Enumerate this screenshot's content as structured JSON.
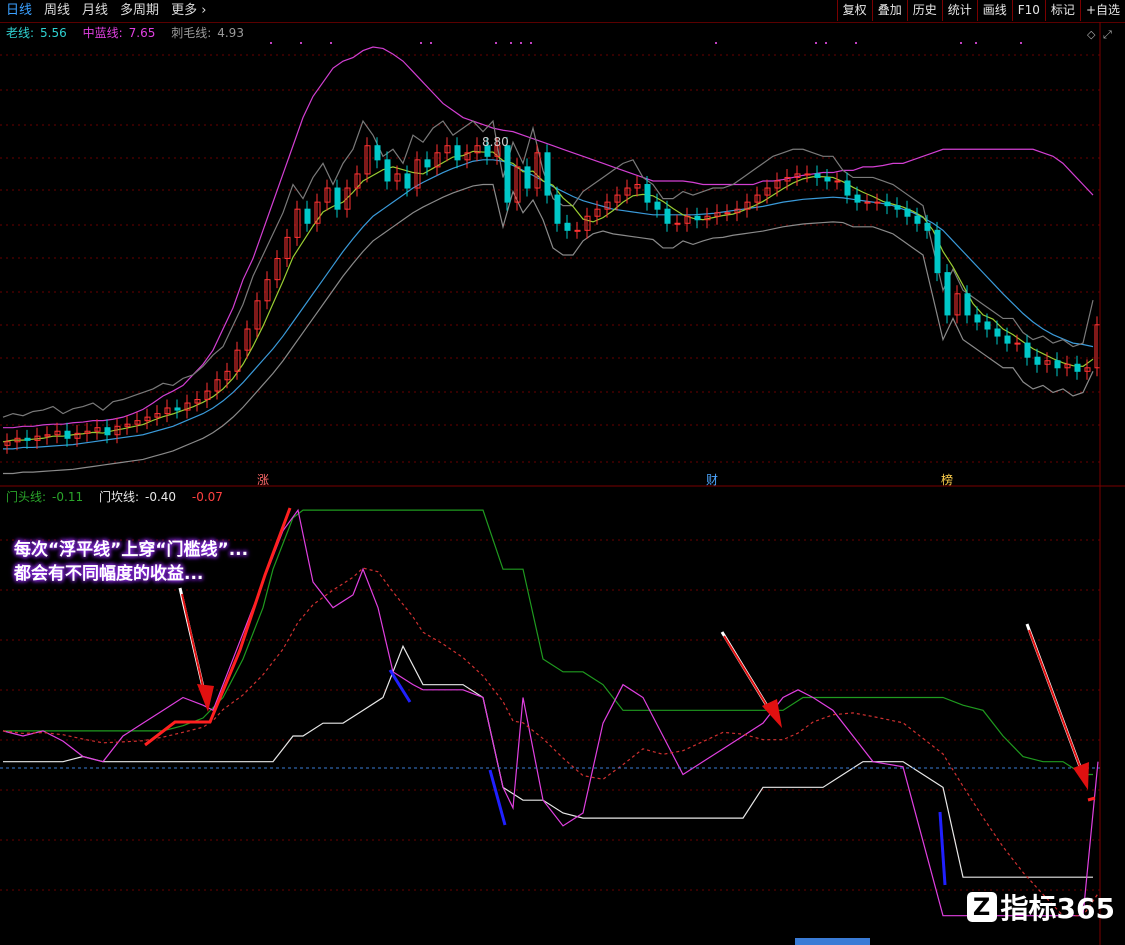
{
  "toolbar": {
    "tabs": [
      "日线",
      "周线",
      "月线",
      "多周期",
      "更多"
    ],
    "right": [
      "复权",
      "叠加",
      "历史",
      "统计",
      "画线",
      "F10",
      "标记",
      "+自选"
    ]
  },
  "main_legend": {
    "old": {
      "label": "老线:",
      "value": "5.56"
    },
    "mid": {
      "label": "中蓝线:",
      "value": "7.65"
    },
    "hair": {
      "label": "刺毛线:",
      "value": "4.93"
    }
  },
  "peak_label": "8.80",
  "markers": [
    "涨",
    "财",
    "榜"
  ],
  "sub_legend": {
    "door": {
      "label": "门头线:",
      "value": "-0.11"
    },
    "kan": {
      "label": "门坎线:",
      "value": "-0.40"
    },
    "extra": "-0.07"
  },
  "annotation": {
    "line1": "每次“浮平线”上穿“门槛线”...",
    "line2": "都会有不同幅度的收益..."
  },
  "logo": {
    "text": "指标365"
  },
  "colors": {
    "up": "#ff3232",
    "down": "#00c8c8",
    "mid": "#3a9ad9",
    "band": "#d23fd2"
  },
  "chart_data": [
    {
      "type": "candlestick",
      "ylim": [
        3.5,
        9.6
      ],
      "x": [
        0,
        10,
        20,
        30,
        40,
        50,
        60,
        70,
        80,
        90,
        100,
        110,
        120,
        130,
        140,
        150,
        160,
        170,
        180,
        190,
        200,
        210,
        220,
        230,
        240,
        250,
        260,
        270,
        280,
        290,
        300,
        310,
        320,
        330,
        340,
        350,
        360,
        370,
        380,
        390,
        400,
        410,
        420,
        430,
        440,
        450,
        460,
        470,
        480,
        490,
        500,
        510,
        520,
        530,
        540,
        550,
        560,
        570,
        580,
        590,
        600,
        610,
        620,
        630,
        640,
        650,
        660,
        670,
        680,
        690,
        700,
        710,
        720,
        730,
        740,
        750,
        760,
        770,
        780,
        790,
        800,
        810,
        820,
        830,
        840,
        850,
        860,
        870,
        880,
        890,
        900,
        910,
        920,
        930,
        940,
        950,
        960,
        970,
        980,
        990,
        1000,
        1010,
        1020,
        1030,
        1040,
        1050,
        1060,
        1070,
        1080,
        1090
      ],
      "close": [
        3.9,
        3.95,
        3.92,
        3.98,
        4.0,
        4.05,
        3.95,
        4.02,
        4.05,
        4.1,
        4.0,
        4.12,
        4.15,
        4.2,
        4.25,
        4.3,
        4.38,
        4.35,
        4.45,
        4.5,
        4.62,
        4.78,
        4.9,
        5.2,
        5.5,
        5.9,
        6.2,
        6.5,
        6.8,
        7.2,
        7.0,
        7.3,
        7.5,
        7.2,
        7.5,
        7.7,
        8.1,
        7.9,
        7.6,
        7.7,
        7.5,
        7.9,
        7.8,
        8.0,
        8.1,
        7.9,
        8.0,
        8.1,
        7.95,
        8.1,
        7.3,
        7.8,
        7.5,
        8.0,
        7.4,
        7.0,
        6.9,
        6.9,
        7.1,
        7.2,
        7.3,
        7.4,
        7.5,
        7.55,
        7.3,
        7.2,
        7.0,
        7.0,
        7.1,
        7.05,
        7.1,
        7.15,
        7.15,
        7.2,
        7.3,
        7.4,
        7.5,
        7.6,
        7.65,
        7.7,
        7.7,
        7.65,
        7.6,
        7.6,
        7.4,
        7.3,
        7.3,
        7.3,
        7.25,
        7.2,
        7.1,
        7.0,
        6.9,
        6.3,
        5.7,
        6.0,
        5.7,
        5.6,
        5.5,
        5.4,
        5.3,
        5.3,
        5.1,
        5.0,
        5.05,
        4.95,
        5.0,
        4.9,
        4.95,
        5.56
      ],
      "band_upper": [
        4.1,
        4.1,
        4.12,
        4.12,
        4.14,
        4.15,
        4.15,
        4.17,
        4.18,
        4.2,
        4.2,
        4.22,
        4.25,
        4.3,
        4.36,
        4.45,
        4.55,
        4.62,
        4.7,
        4.85,
        5.0,
        5.2,
        5.5,
        5.8,
        6.2,
        6.5,
        6.9,
        7.3,
        7.7,
        8.1,
        8.5,
        8.8,
        9.0,
        9.2,
        9.3,
        9.35,
        9.45,
        9.5,
        9.48,
        9.4,
        9.3,
        9.15,
        9.0,
        8.85,
        8.7,
        8.6,
        8.5,
        8.45,
        8.4,
        8.35,
        8.32,
        8.3,
        8.25,
        8.2,
        8.15,
        8.1,
        8.05,
        8.0,
        7.95,
        7.9,
        7.85,
        7.8,
        7.75,
        7.7,
        7.65,
        7.6,
        7.6,
        7.6,
        7.6,
        7.58,
        7.55,
        7.55,
        7.55,
        7.55,
        7.55,
        7.55,
        7.6,
        7.6,
        7.62,
        7.65,
        7.68,
        7.7,
        7.72,
        7.72,
        7.75,
        7.75,
        7.8,
        7.8,
        7.82,
        7.85,
        7.85,
        7.9,
        7.95,
        8.0,
        8.05,
        8.05,
        8.05,
        8.05,
        8.05,
        8.05,
        8.05,
        8.05,
        8.05,
        8.05,
        8.0,
        7.95,
        7.85,
        7.7,
        7.55,
        7.4
      ],
      "mid_blue": [
        3.8,
        3.8,
        3.82,
        3.82,
        3.83,
        3.84,
        3.85,
        3.86,
        3.88,
        3.9,
        3.92,
        3.94,
        3.96,
        3.98,
        4.0,
        4.04,
        4.08,
        4.12,
        4.18,
        4.24,
        4.3,
        4.38,
        4.48,
        4.6,
        4.74,
        4.9,
        5.06,
        5.22,
        5.4,
        5.6,
        5.8,
        6.0,
        6.2,
        6.4,
        6.6,
        6.78,
        6.95,
        7.1,
        7.2,
        7.3,
        7.4,
        7.5,
        7.58,
        7.65,
        7.72,
        7.78,
        7.83,
        7.88,
        7.9,
        7.9,
        7.88,
        7.82,
        7.75,
        7.68,
        7.6,
        7.52,
        7.45,
        7.38,
        7.32,
        7.28,
        7.24,
        7.2,
        7.18,
        7.16,
        7.14,
        7.12,
        7.12,
        7.12,
        7.12,
        7.12,
        7.13,
        7.14,
        7.16,
        7.18,
        7.2,
        7.22,
        7.24,
        7.27,
        7.3,
        7.32,
        7.34,
        7.35,
        7.36,
        7.37,
        7.36,
        7.34,
        7.32,
        7.3,
        7.28,
        7.25,
        7.2,
        7.15,
        7.08,
        7.0,
        6.9,
        6.75,
        6.6,
        6.45,
        6.3,
        6.15,
        6.0,
        5.86,
        5.72,
        5.6,
        5.5,
        5.42,
        5.36,
        5.3,
        5.28,
        5.25
      ]
    },
    {
      "type": "line",
      "ylim": [
        -0.9,
        0.6
      ],
      "x": [
        0,
        20,
        40,
        60,
        80,
        100,
        120,
        140,
        160,
        180,
        200,
        220,
        240,
        260,
        270,
        280,
        290,
        300,
        320,
        340,
        360,
        380,
        400,
        420,
        440,
        460,
        480,
        500,
        520,
        540,
        560,
        580,
        600,
        620,
        640,
        660,
        680,
        700,
        720,
        740,
        760,
        780,
        800,
        820,
        840,
        860,
        880,
        900,
        920,
        940,
        960,
        980,
        1000,
        1020,
        1040,
        1060,
        1080,
        1090
      ],
      "series": [
        {
          "name": "门头线",
          "values": [
            -0.28,
            -0.28,
            -0.28,
            -0.28,
            -0.28,
            -0.28,
            -0.28,
            -0.28,
            -0.28,
            -0.26,
            -0.23,
            -0.15,
            0.0,
            0.2,
            0.35,
            0.45,
            0.55,
            0.58,
            0.58,
            0.58,
            0.58,
            0.58,
            0.58,
            0.58,
            0.58,
            0.58,
            0.58,
            0.35,
            0.35,
            0.0,
            -0.05,
            -0.05,
            -0.1,
            -0.2,
            -0.2,
            -0.2,
            -0.2,
            -0.2,
            -0.2,
            -0.2,
            -0.2,
            -0.2,
            -0.15,
            -0.15,
            -0.15,
            -0.15,
            -0.15,
            -0.15,
            -0.15,
            -0.15,
            -0.18,
            -0.2,
            -0.3,
            -0.38,
            -0.4,
            -0.4,
            -0.45,
            -0.45
          ]
        },
        {
          "name": "门坎线",
          "values": [
            -0.4,
            -0.4,
            -0.4,
            -0.4,
            -0.38,
            -0.4,
            -0.4,
            -0.4,
            -0.4,
            -0.4,
            -0.4,
            -0.4,
            -0.4,
            -0.4,
            -0.4,
            -0.35,
            -0.3,
            -0.3,
            -0.25,
            -0.25,
            -0.2,
            -0.15,
            0.05,
            -0.1,
            -0.1,
            -0.1,
            -0.15,
            -0.5,
            -0.55,
            -0.55,
            -0.6,
            -0.62,
            -0.62,
            -0.62,
            -0.62,
            -0.62,
            -0.62,
            -0.62,
            -0.62,
            -0.62,
            -0.5,
            -0.5,
            -0.5,
            -0.5,
            -0.45,
            -0.4,
            -0.4,
            -0.4,
            -0.45,
            -0.5,
            -0.85,
            -0.85,
            -0.85,
            -0.85,
            -0.85,
            -0.85,
            -0.85,
            -0.85
          ]
        }
      ]
    }
  ]
}
